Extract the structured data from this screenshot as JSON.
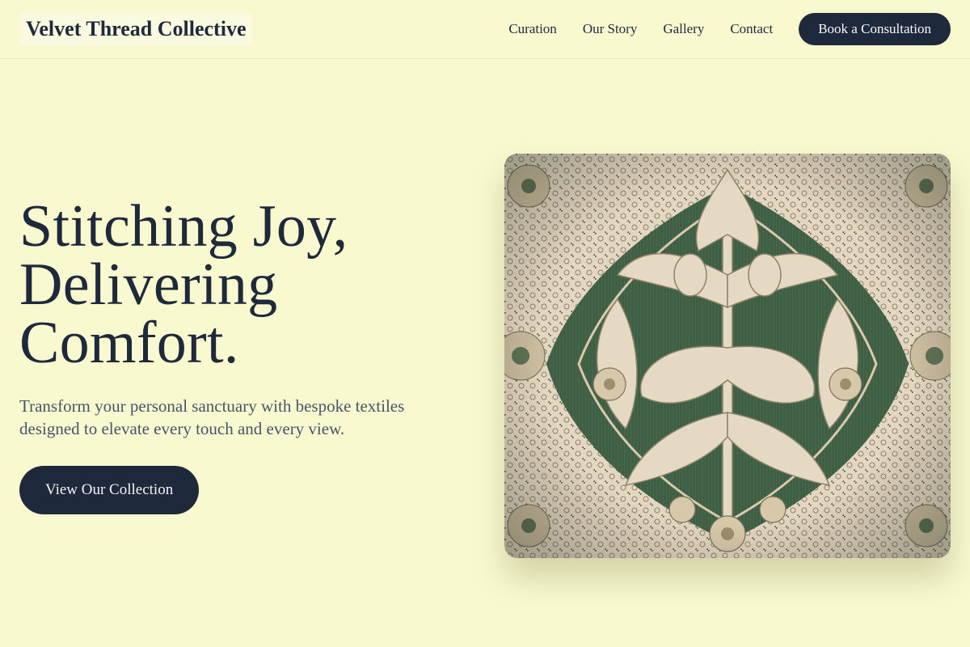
{
  "header": {
    "brand": "Velvet Thread Collective",
    "nav": [
      "Curation",
      "Our Story",
      "Gallery",
      "Contact"
    ],
    "cta_label": "Book a Consultation"
  },
  "hero": {
    "headline_lines": [
      "Stitching Joy,",
      "Delivering",
      "Comfort."
    ],
    "subtitle": "Transform your personal sanctuary with bespoke textiles designed to elevate every touch and every view.",
    "cta_label": "View Our Collection",
    "image_subject": "green and cream damask brocade textile"
  },
  "colors": {
    "background": "#f9f9d0",
    "primary": "#1e293b",
    "text_muted": "#475569",
    "fabric_green": "#3f5f45",
    "fabric_cream": "#e6d9c4"
  }
}
